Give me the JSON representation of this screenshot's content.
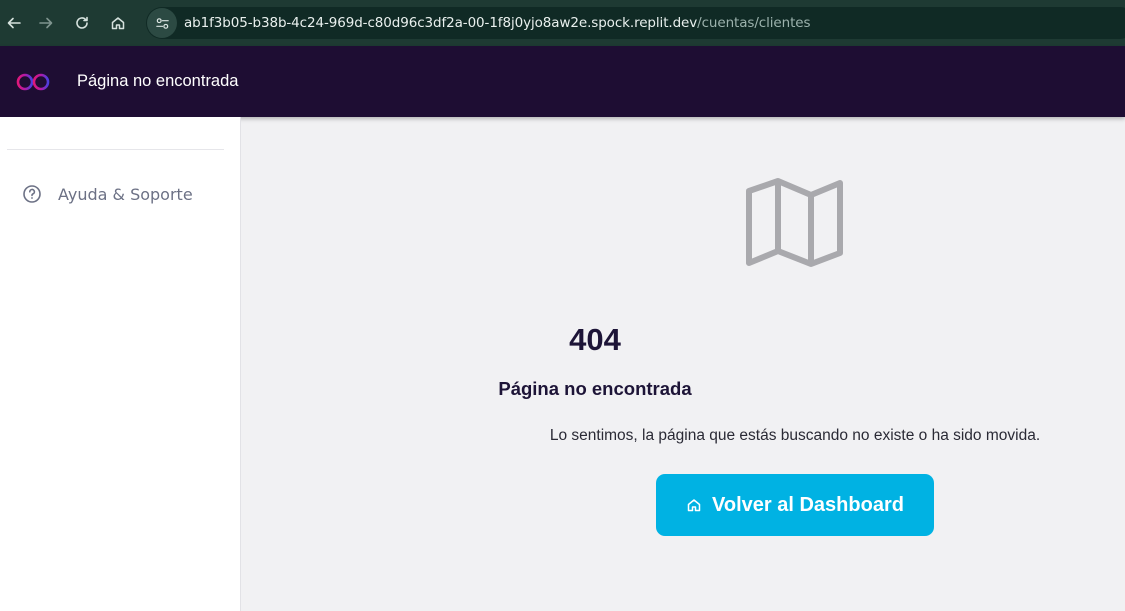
{
  "browser": {
    "url_host": "ab1f3b05-b38b-4c24-969d-c80d96c3df2a-00-1f8j0yjo8aw2e.spock.replit.dev",
    "url_path": "/cuentas/clientes",
    "icons": [
      "back-arrow-icon",
      "forward-arrow-icon",
      "reload-icon",
      "home-icon",
      "site-info-icon"
    ]
  },
  "header": {
    "title": "Página no encontrada",
    "logo": "infinity-logo-icon"
  },
  "sidebar": {
    "items": [
      {
        "label": "Ayuda & Soporte",
        "icon": "help-circle-icon"
      }
    ]
  },
  "error": {
    "icon": "map-icon",
    "code": "404",
    "title": "Página no encontrada",
    "message": "Lo sentimos, la página que estás buscando no existe o ha sido movida.",
    "button_label": "Volver al Dashboard",
    "button_icon": "home-icon"
  },
  "colors": {
    "header_bg": "#1e0d33",
    "accent": "#00b2e3",
    "text_dark": "#1d1437",
    "page_bg": "#f1f1f3"
  }
}
